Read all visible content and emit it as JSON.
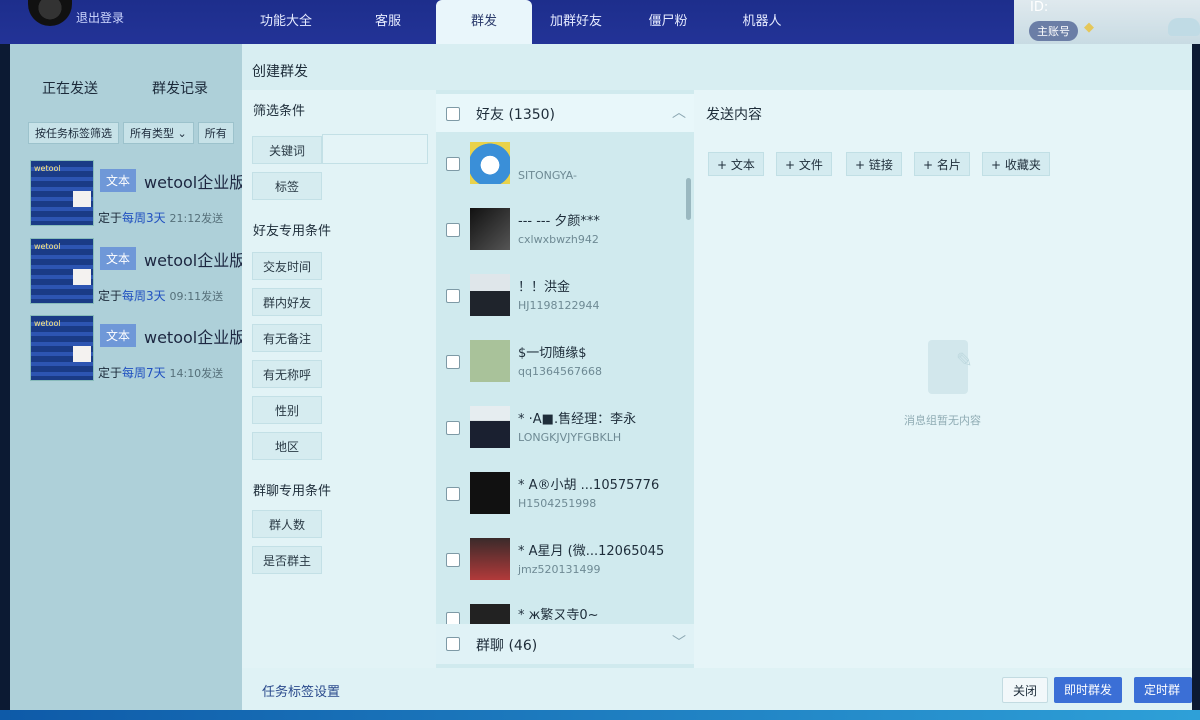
{
  "topbar": {
    "logout": "退出登录",
    "nav": [
      "功能大全",
      "客服",
      "群发",
      "加群好友",
      "僵尸粉",
      "机器人"
    ],
    "active_tab": "群发",
    "id_label": "ID:",
    "account_badge": "主账号"
  },
  "left": {
    "tabs": [
      "正在发送",
      "群发记录"
    ],
    "filters": [
      "按任务标签筛选",
      "所有类型 ⌄",
      "所有"
    ],
    "tasks": [
      {
        "type": "文本",
        "name": "wetool企业版",
        "prefix": "定于",
        "repeat": "每周3天",
        "time": "21:12发送"
      },
      {
        "type": "文本",
        "name": "wetool企业版",
        "prefix": "定于",
        "repeat": "每周3天",
        "time": "09:11发送"
      },
      {
        "type": "文本",
        "name": "wetool企业版",
        "prefix": "定于",
        "repeat": "每周7天",
        "time": "14:10发送"
      }
    ]
  },
  "modal": {
    "title": "创建群发",
    "filters": {
      "heading": "筛选条件",
      "keyword": "关键词",
      "tag": "标签",
      "friend_heading": "好友专用条件",
      "friend_conditions": [
        "交友时间",
        "群内好友",
        "有无备注",
        "有无称呼",
        "性别",
        "地区"
      ],
      "group_heading": "群聊专用条件",
      "group_conditions": [
        "群人数",
        "是否群主"
      ]
    },
    "list": {
      "friends_header": "好友 (1350)",
      "friends": [
        {
          "name": "",
          "id": "SITONGYA-"
        },
        {
          "name": "---  --- 夕颜***",
          "id": "cxlwxbwzh942"
        },
        {
          "name": "！！洪金",
          "id": "HJ1198122944"
        },
        {
          "name": "$一切随缘$",
          "id": "qq1364567668"
        },
        {
          "name": "*  ·A■.售经理：李永",
          "id": "LONGKJVJYFGBKLH"
        },
        {
          "name": "*  A®小胡 ...10575776",
          "id": "H1504251998"
        },
        {
          "name": "*  A星月 (微...12065045",
          "id": "jmz520131499"
        },
        {
          "name": "* ж繁ㄡ寺0~",
          "id": ""
        }
      ],
      "groups_header": "群聊 (46)"
    },
    "content": {
      "heading": "发送内容",
      "add_buttons": [
        "+ 文本",
        "+ 文件",
        "+ 链接",
        "+ 名片",
        "+ 收藏夹"
      ],
      "empty_text": "消息组暂无内容"
    },
    "footer": {
      "task_tag_settings": "任务标签设置",
      "close": "关闭",
      "send_now": "即时群发",
      "send_timed": "定时群发"
    }
  },
  "colors": {
    "topbar": "#233397",
    "accent_blue": "#3b6fd6",
    "modal_bg": "#d8eef2"
  }
}
